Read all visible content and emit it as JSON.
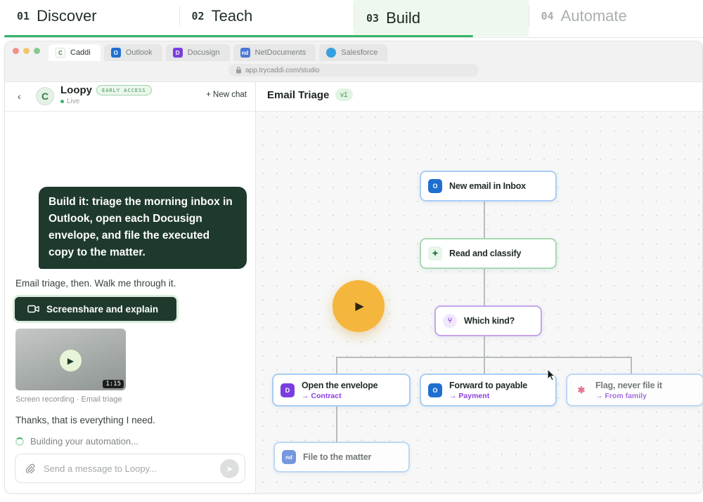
{
  "steps": [
    {
      "num": "01",
      "label": "Discover"
    },
    {
      "num": "02",
      "label": "Teach"
    },
    {
      "num": "03",
      "label": "Build"
    },
    {
      "num": "04",
      "label": "Automate"
    }
  ],
  "browser": {
    "tabs": [
      {
        "label": "Caddi",
        "icon": "caddi-icon",
        "color": "#2f7a45"
      },
      {
        "label": "Outlook",
        "icon": "outlook-icon",
        "color": "#1e6fd0"
      },
      {
        "label": "Docusign",
        "icon": "docusign-icon",
        "color": "#7a3de0"
      },
      {
        "label": "NetDocuments",
        "icon": "netdocuments-icon",
        "color": "#4a78d6"
      },
      {
        "label": "Salesforce",
        "icon": "salesforce-icon",
        "color": "#35a0e0"
      }
    ],
    "url": "app.trycaddi.com/studio"
  },
  "chat": {
    "agent_name": "Loopy",
    "badge": "EARLY ACCESS",
    "status": "Live",
    "new_chat": "+ New chat",
    "user_prompt": "Build it: triage the morning inbox in Outlook, open each Docusign envelope, and file the executed copy to the matter.",
    "reply": "Email triage, then. Walk me through it.",
    "screenshare_label": "Screenshare and explain",
    "video_duration": "1:15",
    "video_caption": "Screen recording · Email triage",
    "followup": "Thanks, that is everything I need.",
    "building_status": "Building your automation...",
    "composer_placeholder": "Send a message to Loopy..."
  },
  "workflow": {
    "title": "Email Triage",
    "version": "v1",
    "nodes": {
      "trigger": {
        "title": "New email in Inbox"
      },
      "classify": {
        "title": "Read and classify"
      },
      "branch": {
        "title": "Which kind?"
      },
      "envelope": {
        "title": "Open the envelope",
        "sub": "→ Contract"
      },
      "payable": {
        "title": "Forward to payable",
        "sub": "→ Payment"
      },
      "flag": {
        "title": "Flag, never file it",
        "sub": "→ From family"
      },
      "file": {
        "title": "File to the matter"
      }
    }
  },
  "colors": {
    "accent_green": "#35b36a",
    "dark_green": "#1e3a2c",
    "play_yellow": "#f4b63d",
    "branch_purple": "#8a3fe0"
  }
}
